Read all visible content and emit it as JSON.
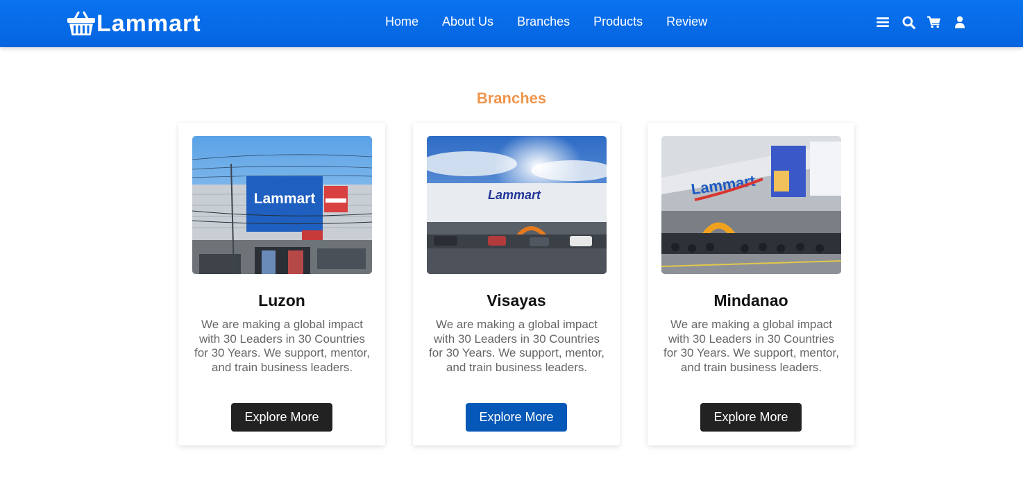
{
  "brand": {
    "name": "Lammart",
    "icon": "basket-icon"
  },
  "nav": {
    "items": [
      {
        "label": "Home"
      },
      {
        "label": "About Us"
      },
      {
        "label": "Branches"
      },
      {
        "label": "Products"
      },
      {
        "label": "Review"
      }
    ]
  },
  "toolbar": {
    "icons": [
      "menu-icon",
      "search-icon",
      "cart-icon",
      "user-icon"
    ]
  },
  "colors": {
    "header": "#0a73f0",
    "section_title": "#f0954c",
    "button_dark": "#222222",
    "button_active": "#0558b8"
  },
  "section": {
    "title": "Branches"
  },
  "branches": [
    {
      "title": "Luzon",
      "description": "We are making a global impact with 30 Leaders in 30 Countries for 30 Years. We support, mentor, and train business leaders.",
      "button": "Explore More",
      "image_sign": "Lammart"
    },
    {
      "title": "Visayas",
      "description": "We are making a global impact with 30 Leaders in 30 Countries for 30 Years. We support, mentor, and train business leaders.",
      "button": "Explore More",
      "image_sign": "Lammart"
    },
    {
      "title": "Mindanao",
      "description": "We are making a global impact with 30 Leaders in 30 Countries for 30 Years. We support, mentor, and train business leaders.",
      "button": "Explore More",
      "image_sign": "Lammart"
    }
  ]
}
